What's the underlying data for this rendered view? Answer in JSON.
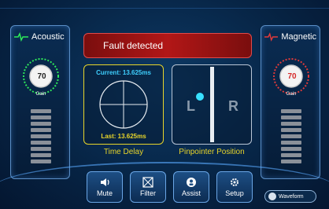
{
  "acoustic": {
    "title": "Acoustic",
    "gain_value": "70",
    "gain_label": "Gain",
    "min": "0",
    "max": "100"
  },
  "magnetic": {
    "title": "Magnetic",
    "gain_value": "70",
    "gain_label": "Gain",
    "min": "0",
    "max": "100"
  },
  "fault": {
    "text": "Fault detected"
  },
  "time_delay": {
    "current": "Current: 13.625ms",
    "last": "Last: 13.625ms",
    "caption": "Time Delay"
  },
  "pinpointer": {
    "left": "L",
    "right": "R",
    "caption": "Pinpointer Position",
    "position": -0.4
  },
  "toolbar": {
    "mute": "Mute",
    "filter": "Filter",
    "assist": "Assist",
    "setup": "Setup"
  },
  "waveform": {
    "label": "Waveform"
  },
  "colors": {
    "fault": "#b21717",
    "time_delay": "#e8d52a",
    "accent": "#3fd0ff"
  }
}
